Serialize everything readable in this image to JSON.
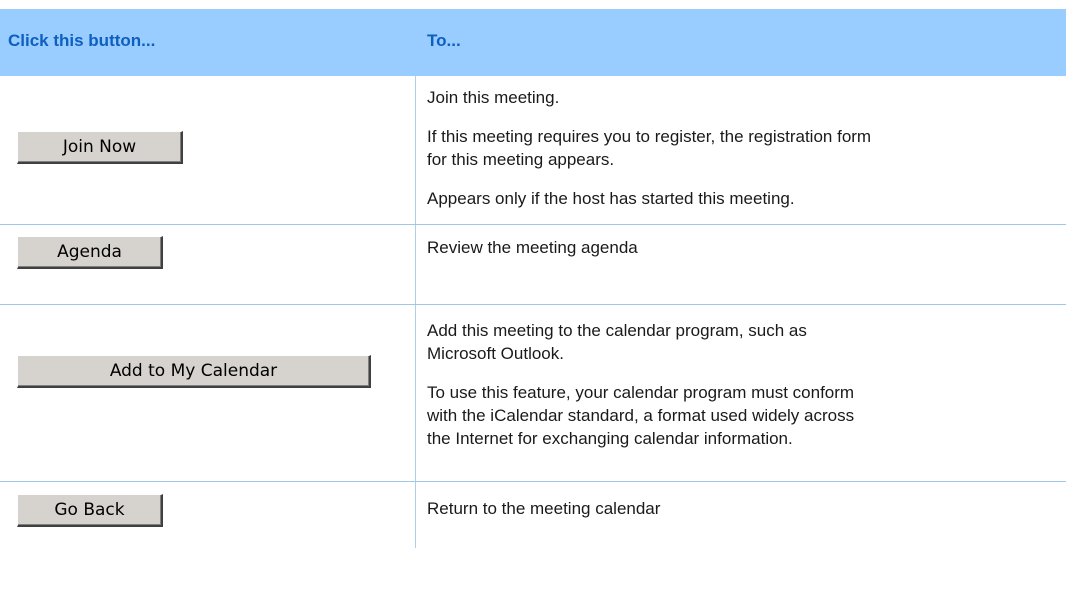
{
  "header": {
    "col1": "Click this button...",
    "col2": "To..."
  },
  "rows": [
    {
      "button_label": "Join Now",
      "descriptions": [
        "Join this meeting.",
        "If this meeting requires you to register, the registration form",
        "for this meeting appears.",
        "Appears only if the host has started this meeting."
      ]
    },
    {
      "button_label": "Agenda",
      "descriptions": [
        "Review the meeting agenda"
      ]
    },
    {
      "button_label": "Add to My Calendar",
      "descriptions": [
        "Add this meeting to the calendar program, such as",
        "Microsoft Outlook.",
        "To use this feature, your calendar program must conform",
        "with the iCalendar standard, a format used widely across",
        "the Internet for exchanging calendar information."
      ]
    },
    {
      "button_label": "Go Back",
      "descriptions": [
        "Return to the meeting calendar"
      ]
    }
  ]
}
